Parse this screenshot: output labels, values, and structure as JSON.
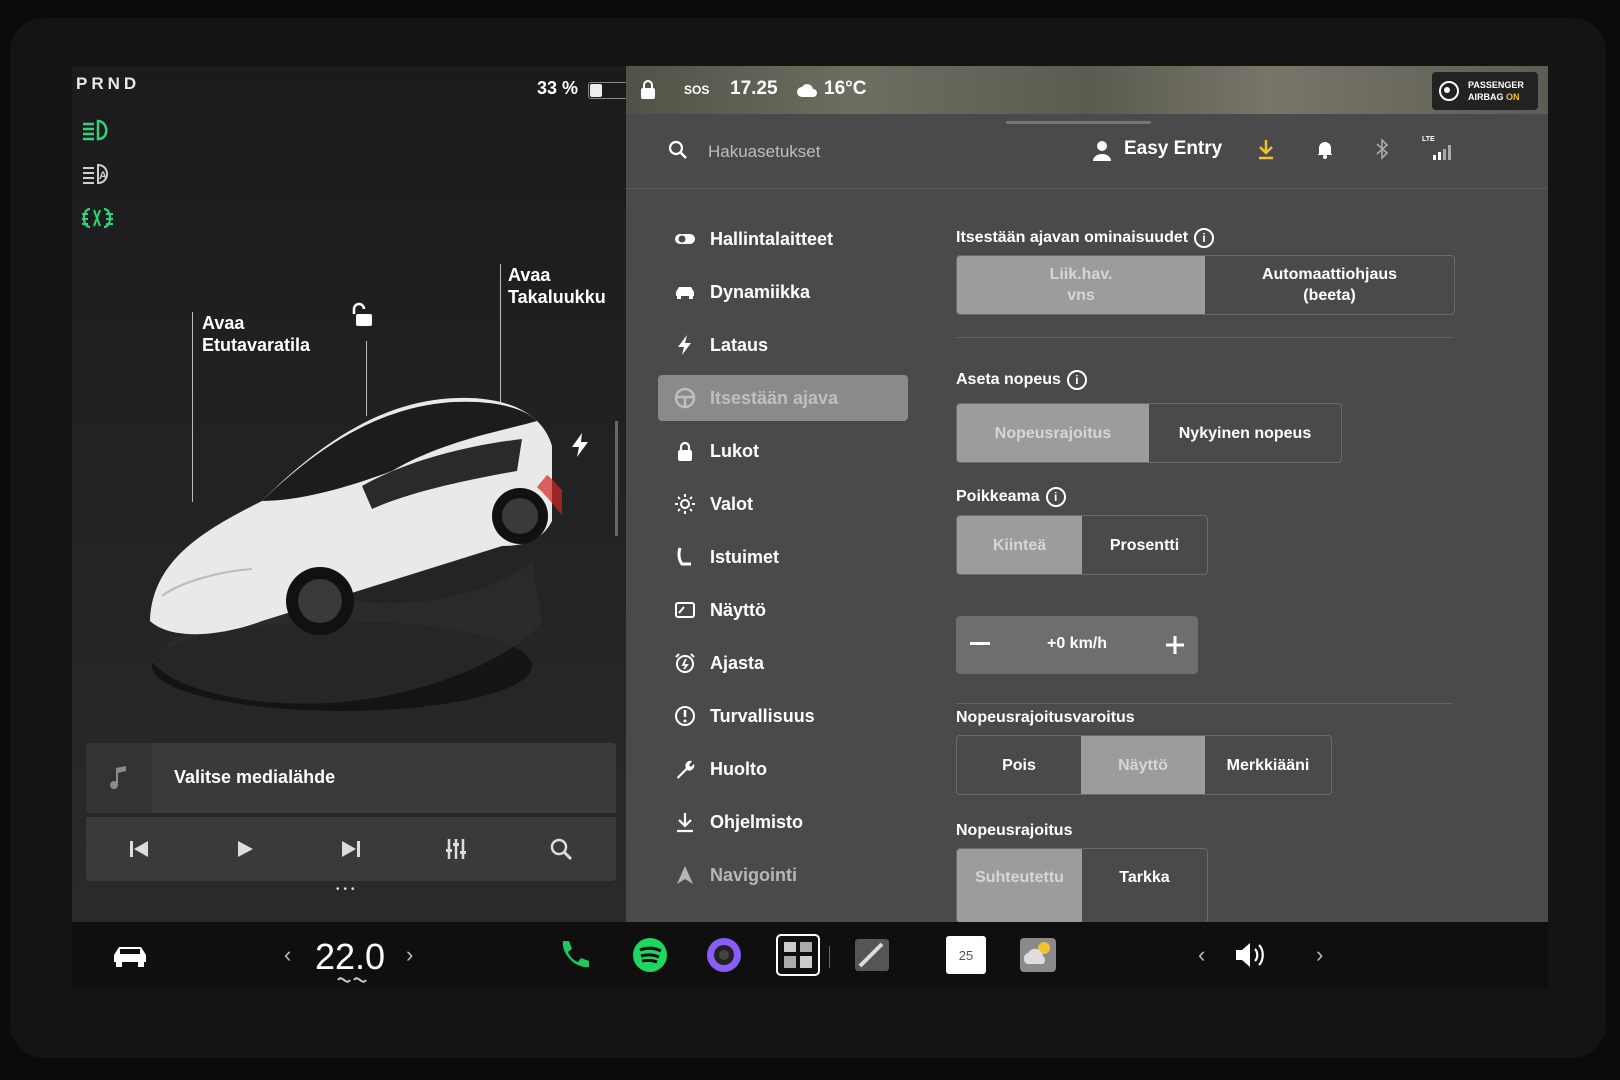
{
  "left_panel": {
    "gear": "PRND",
    "battery": {
      "percent_text": "33 %",
      "level_fraction": 0.33
    },
    "car_labels": {
      "frunk": "Avaa\nEtutavaratila",
      "trunk": "Avaa\nTakaluukku"
    },
    "media": {
      "source_text": "Valitse medialähde"
    }
  },
  "top_status": {
    "sos": "SOS",
    "time": "17.25",
    "temperature": "16°C",
    "airbag": {
      "line1": "PASSENGER",
      "line2": "AIRBAG",
      "state": "ON",
      "state_color": "#f2c12e"
    }
  },
  "header": {
    "search_placeholder": "Hakuasetukset",
    "profile_name": "Easy Entry",
    "lte": "LTE",
    "download_color": "#f2c12e"
  },
  "nav": {
    "items": [
      {
        "label": "Hallintalaitteet",
        "icon": "toggle-icon"
      },
      {
        "label": "Dynamiikka",
        "icon": "car-icon"
      },
      {
        "label": "Lataus",
        "icon": "bolt-icon"
      },
      {
        "label": "Itsestään ajava",
        "icon": "steering-wheel-icon",
        "active": true
      },
      {
        "label": "Lukot",
        "icon": "lock-icon"
      },
      {
        "label": "Valot",
        "icon": "sun-icon"
      },
      {
        "label": "Istuimet",
        "icon": "seat-icon"
      },
      {
        "label": "Näyttö",
        "icon": "display-icon"
      },
      {
        "label": "Ajasta",
        "icon": "alarm-clock-icon"
      },
      {
        "label": "Turvallisuus",
        "icon": "safety-icon"
      },
      {
        "label": "Huolto",
        "icon": "wrench-icon"
      },
      {
        "label": "Ohjelmisto",
        "icon": "download-icon"
      },
      {
        "label": "Navigointi",
        "icon": "navigation-icon"
      }
    ]
  },
  "settings": {
    "self_driving": {
      "title": "Itsestään ajavan ominaisuudet",
      "options": [
        "Liik.hav.\nvns",
        "Automaattiohjaus\n(beeta)"
      ],
      "selected": 0
    },
    "set_speed": {
      "title": "Aseta nopeus",
      "options": [
        "Nopeusrajoitus",
        "Nykyinen nopeus"
      ],
      "selected": 0
    },
    "offset": {
      "title": "Poikkeama",
      "options": [
        "Kiinteä",
        "Prosentti"
      ],
      "selected": 0,
      "value": "+0 km/h"
    },
    "speed_limit_warning": {
      "title": "Nopeusrajoitusvaroitus",
      "options": [
        "Pois",
        "Näyttö",
        "Merkkiääni"
      ],
      "selected": 1
    },
    "speed_limit": {
      "title": "Nopeusrajoitus",
      "options": [
        "Suhteutettu",
        "Tarkka"
      ],
      "selected": 0
    }
  },
  "dock": {
    "cabin_temp": "22.0",
    "calendar_day": "25",
    "spotify_color": "#1ed760",
    "phone_color": "#22c55e"
  }
}
